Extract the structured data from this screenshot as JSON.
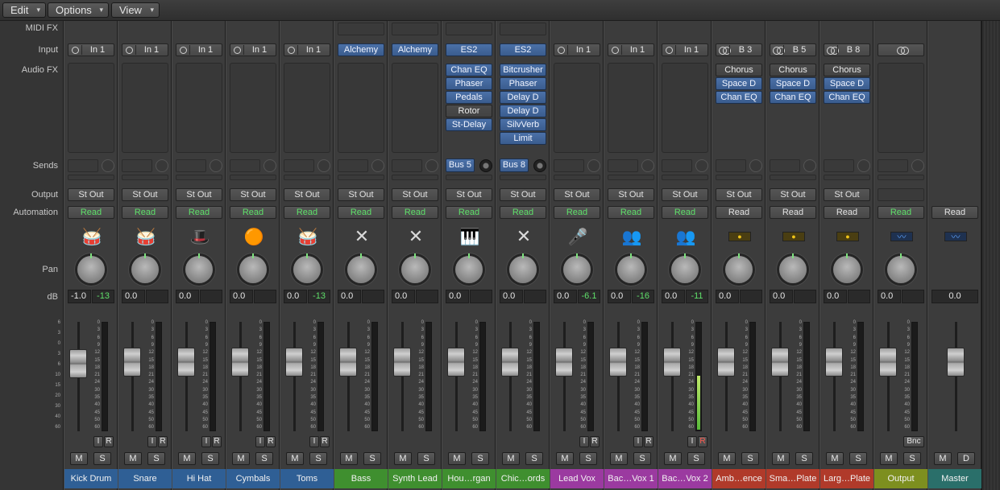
{
  "menu": [
    {
      "label": "Edit",
      "caret": "▾"
    },
    {
      "label": "Options",
      "caret": "▾"
    },
    {
      "label": "View",
      "caret": "▾"
    }
  ],
  "row_labels": {
    "midi_fx": "MIDI FX",
    "input": "Input",
    "audio_fx": "Audio FX",
    "sends": "Sends",
    "output": "Output",
    "automation": "Automation",
    "pan": "Pan",
    "db": "dB"
  },
  "fader_scale": [
    "6",
    "3",
    "0",
    "3",
    "6",
    "10",
    "15",
    "20",
    "30",
    "40",
    "60"
  ],
  "meter_scale": [
    "0",
    "3",
    "6",
    "9",
    "12",
    "15",
    "18",
    "21",
    "24",
    "30",
    "35",
    "40",
    "45",
    "50",
    "60"
  ],
  "strips": [
    {
      "name": "Kick Drum",
      "color": "#2f5f95",
      "input": "In 1",
      "input_type": "mono",
      "fx": [],
      "send": null,
      "output": "St Out",
      "automation": "Read",
      "automation_color": "green",
      "icon": "kick-drum-icon",
      "icon_glyph": "🥁",
      "db_left": "-1.0",
      "db_right": "-13",
      "ir": [
        "I",
        "R"
      ],
      "ms": [
        "M",
        "S"
      ],
      "fader_level": 0.58,
      "meter_level": 0
    },
    {
      "name": "Snare",
      "color": "#2f5f95",
      "input": "In 1",
      "input_type": "mono",
      "fx": [],
      "send": null,
      "output": "St Out",
      "automation": "Read",
      "automation_color": "green",
      "icon": "snare-drum-icon",
      "icon_glyph": "🥁",
      "db_left": "0.0",
      "db_right": "",
      "ir": [
        "I",
        "R"
      ],
      "ms": [
        "M",
        "S"
      ],
      "fader_level": 0.6,
      "meter_level": 0
    },
    {
      "name": "Hi Hat",
      "color": "#2f5f95",
      "input": "In 1",
      "input_type": "mono",
      "fx": [],
      "send": null,
      "output": "St Out",
      "automation": "Read",
      "automation_color": "green",
      "icon": "hi-hat-icon",
      "icon_glyph": "🎩",
      "db_left": "0.0",
      "db_right": "",
      "ir": [
        "I",
        "R"
      ],
      "ms": [
        "M",
        "S"
      ],
      "fader_level": 0.6,
      "meter_level": 0
    },
    {
      "name": "Cymbals",
      "color": "#2f5f95",
      "input": "In 1",
      "input_type": "mono",
      "fx": [],
      "send": null,
      "output": "St Out",
      "automation": "Read",
      "automation_color": "green",
      "icon": "cymbal-icon",
      "icon_glyph": "🟠",
      "db_left": "0.0",
      "db_right": "",
      "ir": [
        "I",
        "R"
      ],
      "ms": [
        "M",
        "S"
      ],
      "fader_level": 0.6,
      "meter_level": 0
    },
    {
      "name": "Toms",
      "color": "#2f5f95",
      "input": "In 1",
      "input_type": "mono",
      "fx": [],
      "send": null,
      "output": "St Out",
      "automation": "Read",
      "automation_color": "green",
      "icon": "tom-drum-icon",
      "icon_glyph": "🥁",
      "db_left": "0.0",
      "db_right": "-13",
      "ir": [
        "I",
        "R"
      ],
      "ms": [
        "M",
        "S"
      ],
      "fader_level": 0.6,
      "meter_level": 0
    },
    {
      "name": "Bass",
      "color": "#3f8f2f",
      "input": "Alchemy",
      "input_type": "instrument",
      "fx": [],
      "send": null,
      "output": "St Out",
      "automation": "Read",
      "automation_color": "green",
      "icon": "keyboard-stand-icon",
      "icon_glyph": "✕",
      "db_left": "0.0",
      "db_right": "",
      "ir": [],
      "ms": [
        "M",
        "S"
      ],
      "fader_level": 0.6,
      "meter_level": 0
    },
    {
      "name": "Synth Lead",
      "color": "#3f8f2f",
      "input": "Alchemy",
      "input_type": "instrument",
      "fx": [],
      "send": null,
      "output": "St Out",
      "automation": "Read",
      "automation_color": "green",
      "icon": "keyboard-stand-icon",
      "icon_glyph": "✕",
      "db_left": "0.0",
      "db_right": "",
      "ir": [],
      "ms": [
        "M",
        "S"
      ],
      "fader_level": 0.6,
      "meter_level": 0
    },
    {
      "name": "Hou…rgan",
      "color": "#3f8f2f",
      "input": "ES2",
      "input_type": "instrument",
      "fx": [
        "Chan EQ",
        "Phaser",
        "Pedals",
        "Rotor",
        "St-Delay"
      ],
      "fx_dark": [
        3
      ],
      "send": "Bus 5",
      "output": "St Out",
      "automation": "Read",
      "automation_color": "green",
      "icon": "organ-keyboard-icon",
      "icon_glyph": "🎹",
      "db_left": "0.0",
      "db_right": "",
      "ir": [],
      "ms": [
        "M",
        "S"
      ],
      "fader_level": 0.6,
      "meter_level": 0
    },
    {
      "name": "Chic…ords",
      "color": "#3f8f2f",
      "input": "ES2",
      "input_type": "instrument",
      "fx": [
        "Bitcrusher",
        "Phaser",
        "Delay D",
        "Delay D",
        "SilvVerb",
        "Limit"
      ],
      "fx_dark": [],
      "send": "Bus 8",
      "output": "St Out",
      "automation": "Read",
      "automation_color": "green",
      "icon": "keyboard-stand-icon",
      "icon_glyph": "✕",
      "db_left": "0.0",
      "db_right": "",
      "ir": [],
      "ms": [
        "M",
        "S"
      ],
      "fader_level": 0.6,
      "meter_level": 0
    },
    {
      "name": "Lead Vox",
      "color": "#9b3aa0",
      "input": "In 1",
      "input_type": "mono",
      "fx": [],
      "send": null,
      "output": "St Out",
      "automation": "Read",
      "automation_color": "green",
      "icon": "microphone-icon",
      "icon_glyph": "🎤",
      "db_left": "0.0",
      "db_right": "-6.1",
      "ir": [
        "I",
        "R"
      ],
      "ms": [
        "M",
        "S"
      ],
      "fader_level": 0.6,
      "meter_level": 0
    },
    {
      "name": "Bac…Vox 1",
      "color": "#9b3aa0",
      "input": "In 1",
      "input_type": "mono",
      "fx": [],
      "send": null,
      "output": "St Out",
      "automation": "Read",
      "automation_color": "green",
      "icon": "choir-icon",
      "icon_glyph": "👥",
      "db_left": "0.0",
      "db_right": "-16",
      "ir": [
        "I",
        "R"
      ],
      "ms": [
        "M",
        "S"
      ],
      "fader_level": 0.6,
      "meter_level": 0
    },
    {
      "name": "Bac…Vox 2",
      "color": "#9b3aa0",
      "input": "In 1",
      "input_type": "mono",
      "fx": [],
      "send": null,
      "output": "St Out",
      "automation": "Read",
      "automation_color": "green",
      "icon": "choir-icon",
      "icon_glyph": "👥",
      "db_left": "0.0",
      "db_right": "-11",
      "ir": [
        "I",
        "R"
      ],
      "ir_red": true,
      "ms": [
        "M",
        "S"
      ],
      "fader_level": 0.6,
      "meter_level": 0.5
    },
    {
      "name": "Amb…ence",
      "color": "#b03a2a",
      "input": "B 3",
      "input_type": "stereo",
      "fx": [
        "Chorus",
        "Space D",
        "Chan EQ"
      ],
      "fx_dark": [
        0
      ],
      "send": null,
      "output": "St Out",
      "automation": "Read",
      "automation_color": "white",
      "icon": "aux-meter-icon",
      "icon_glyph": "●",
      "db_left": "0.0",
      "db_right": "",
      "ir": [],
      "ms": [
        "M",
        "S"
      ],
      "fader_level": 0.6,
      "meter_level": 0
    },
    {
      "name": "Sma…Plate",
      "color": "#b03a2a",
      "input": "B 5",
      "input_type": "stereo",
      "fx": [
        "Chorus",
        "Space D",
        "Chan EQ"
      ],
      "fx_dark": [
        0
      ],
      "send": null,
      "output": "St Out",
      "automation": "Read",
      "automation_color": "white",
      "icon": "aux-meter-icon",
      "icon_glyph": "●",
      "db_left": "0.0",
      "db_right": "",
      "ir": [],
      "ms": [
        "M",
        "S"
      ],
      "fader_level": 0.6,
      "meter_level": 0
    },
    {
      "name": "Larg…Plate",
      "color": "#b03a2a",
      "input": "B 8",
      "input_type": "stereo",
      "fx": [
        "Chorus",
        "Space D",
        "Chan EQ"
      ],
      "fx_dark": [
        0
      ],
      "send": null,
      "output": "St Out",
      "automation": "Read",
      "automation_color": "white",
      "icon": "aux-meter-icon",
      "icon_glyph": "●",
      "db_left": "0.0",
      "db_right": "",
      "ir": [],
      "ms": [
        "M",
        "S"
      ],
      "fader_level": 0.6,
      "meter_level": 0
    },
    {
      "name": "Output",
      "color": "#7d8f1f",
      "input": "",
      "input_type": "stereo-only",
      "fx": [],
      "send": null,
      "output": "",
      "automation": "Read",
      "automation_color": "green",
      "icon": "waveform-icon",
      "icon_glyph": "〰",
      "db_left": "0.0",
      "db_right": "",
      "ir": [],
      "bnc": "Bnc",
      "ms": [
        "M",
        "S"
      ],
      "fader_level": 0.6,
      "meter_level": 0
    },
    {
      "name": "Master",
      "color": "#2a6f6a",
      "input": null,
      "input_type": "none",
      "fx": [],
      "send": null,
      "output": "",
      "automation": "Read",
      "automation_color": "white",
      "icon": "waveform-icon",
      "icon_glyph": "〰",
      "db_left": "0.0",
      "db_right": null,
      "ir": [],
      "ms": [
        "M",
        "D"
      ],
      "fader_level": 0.6,
      "meter_level": null
    }
  ]
}
